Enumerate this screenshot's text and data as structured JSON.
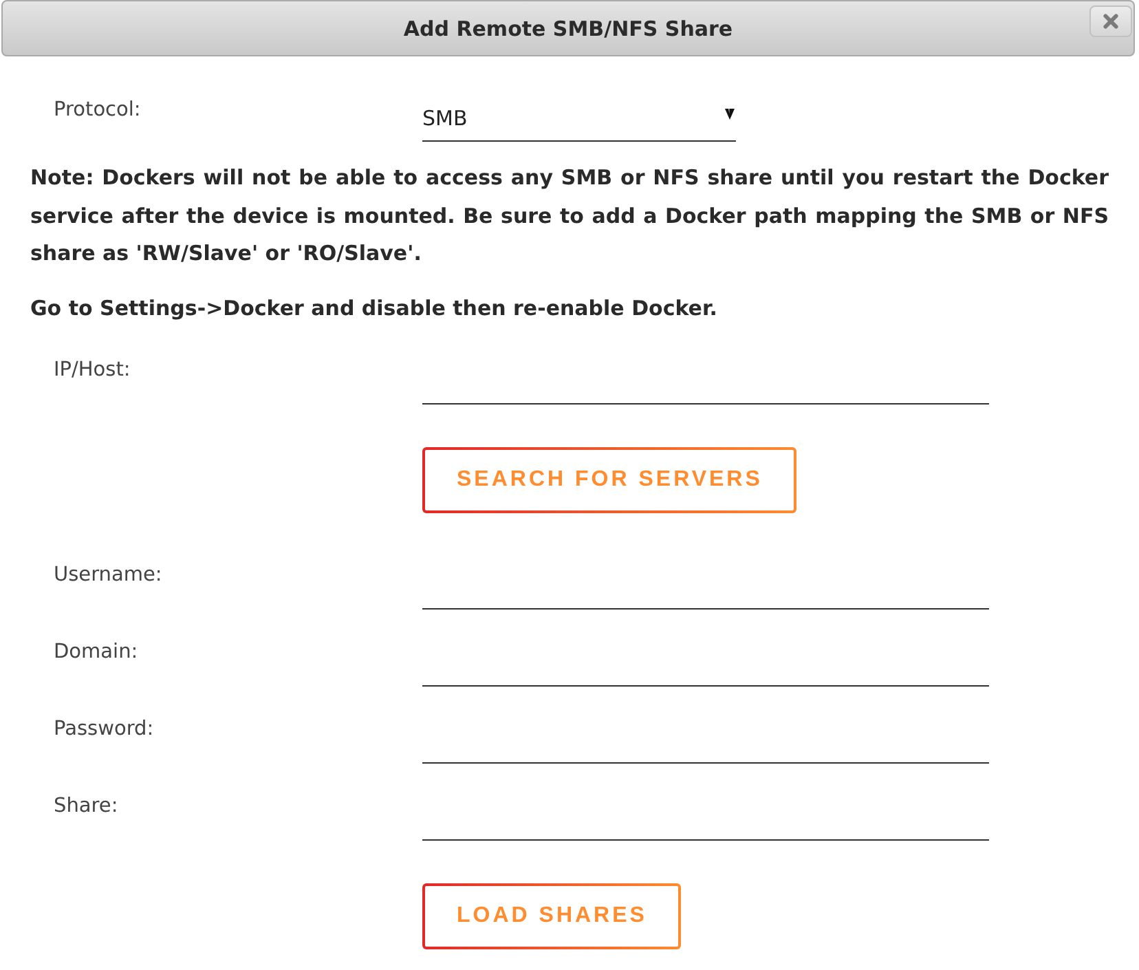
{
  "dialog": {
    "title": "Add Remote SMB/NFS Share"
  },
  "protocol": {
    "label": "Protocol:",
    "value": "SMB"
  },
  "notes": [
    "Note: Dockers will not be able to access any SMB or NFS share until you restart the Docker service after the device is mounted. Be sure to add a Docker path mapping the SMB or NFS share as 'RW/Slave' or 'RO/Slave'.",
    "Go to Settings->Docker and disable then re-enable Docker."
  ],
  "form_rows": [
    {
      "kind": "field",
      "label": "IP/Host:"
    },
    {
      "kind": "button",
      "label": "SEARCH FOR SERVERS"
    },
    {
      "kind": "field",
      "label": "Username:"
    },
    {
      "kind": "field",
      "label": "Domain:"
    },
    {
      "kind": "field",
      "label": "Password:"
    },
    {
      "kind": "field",
      "label": "Share:"
    },
    {
      "kind": "button",
      "label": "LOAD SHARES"
    }
  ]
}
